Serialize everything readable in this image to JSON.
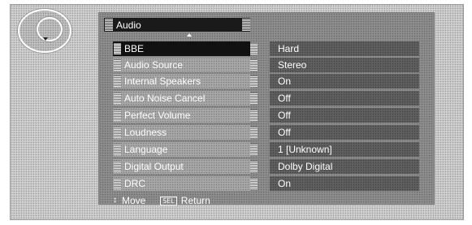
{
  "menu": {
    "title": "Audio",
    "items": [
      {
        "label": "BBE",
        "value": "Hard",
        "selected": true
      },
      {
        "label": "Audio Source",
        "value": "Stereo"
      },
      {
        "label": "Internal Speakers",
        "value": "On"
      },
      {
        "label": "Auto Noise Cancel",
        "value": "Off"
      },
      {
        "label": "Perfect Volume",
        "value": "Off"
      },
      {
        "label": "Loudness",
        "value": "Off"
      },
      {
        "label": "Language",
        "value": "1 [Unknown]"
      },
      {
        "label": "Digital Output",
        "value": "Dolby Digital"
      },
      {
        "label": "DRC",
        "value": "On"
      }
    ]
  },
  "footer": {
    "move_icon": "up-down-arrow-icon",
    "move_label": "Move",
    "sel_badge": "SEL",
    "return_label": "Return"
  },
  "icons": {
    "dpad": "dpad-down-icon",
    "scroll_up": "scroll-up-arrow-icon"
  }
}
